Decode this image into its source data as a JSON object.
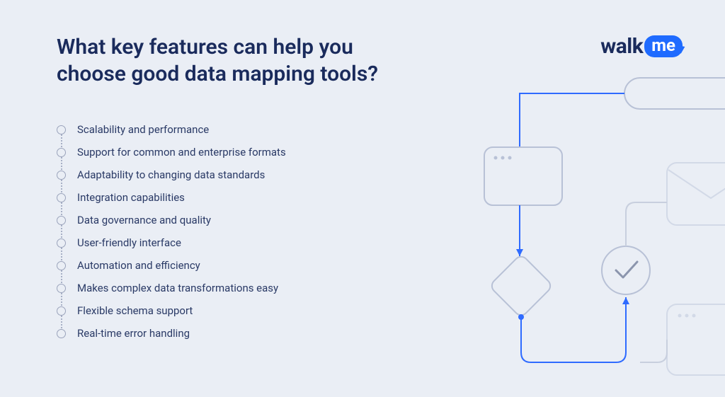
{
  "title": "What key features can help you choose good data mapping tools?",
  "logo": {
    "part1": "walk",
    "part2": "me"
  },
  "features": [
    {
      "label": "Scalability and performance"
    },
    {
      "label": "Support for common and enterprise formats"
    },
    {
      "label": "Adaptability to changing data standards"
    },
    {
      "label": "Integration capabilities"
    },
    {
      "label": "Data governance and quality"
    },
    {
      "label": "User-friendly interface"
    },
    {
      "label": "Automation and efficiency"
    },
    {
      "label": "Makes complex data transformations easy"
    },
    {
      "label": "Flexible schema support"
    },
    {
      "label": "Real-time error handling"
    }
  ]
}
